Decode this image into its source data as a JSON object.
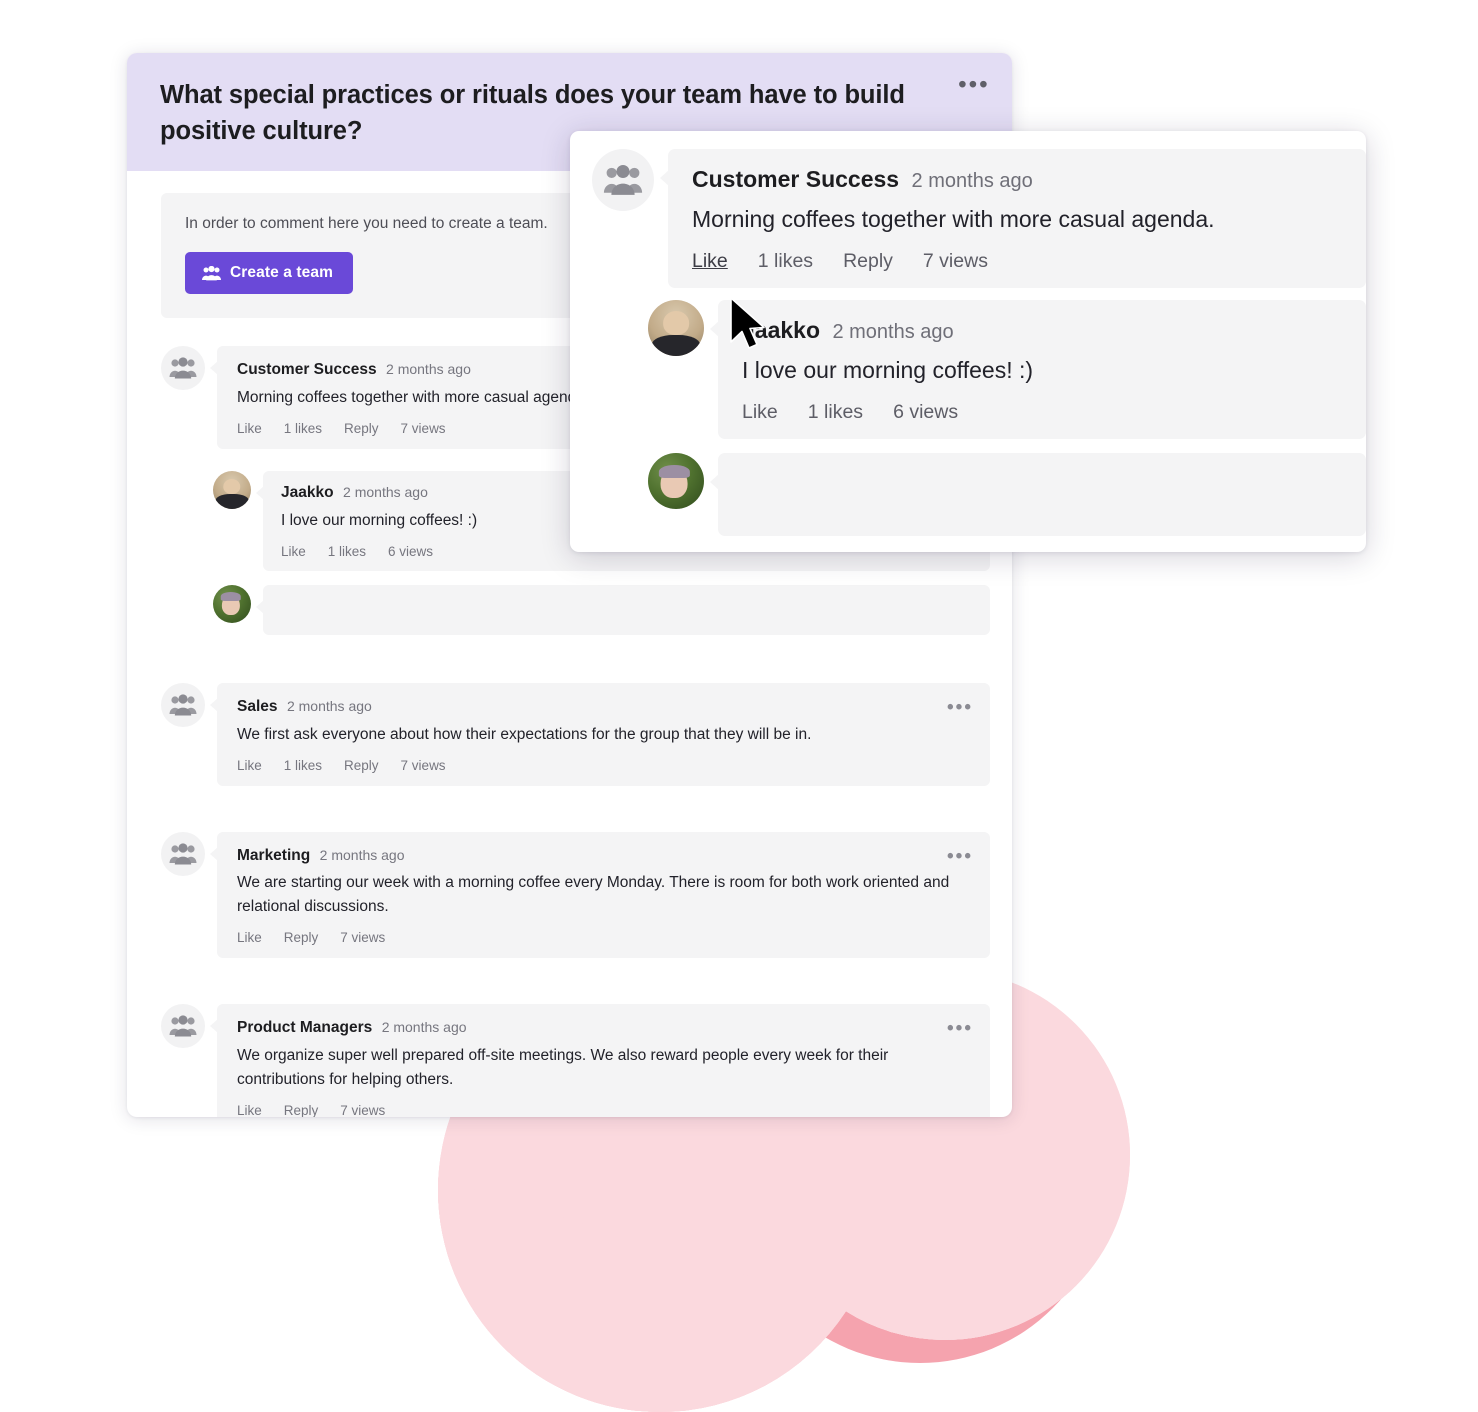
{
  "question": {
    "title": "What special practices or rituals does your team have to build positive culture?",
    "menu_icon": "•••"
  },
  "compose": {
    "notice": "In order to comment here you need to create a team.",
    "create_team_label": "Create a team",
    "create_team_icon": "users-group-icon"
  },
  "colors": {
    "header_bg": "#e3ddf4",
    "brand_purple": "#6a49d8",
    "bubble_bg": "#f4f4f5",
    "blob_pink_dark": "#f5a3ae",
    "blob_pink_light": "#fbd9de"
  },
  "comments": [
    {
      "author": "Customer Success",
      "time": "2 months ago",
      "body": "Morning coffees together with more casual agenda.",
      "actions": {
        "like": "Like",
        "likes": "1 likes",
        "reply": "Reply",
        "views": "7 views"
      },
      "avatar": "group-avatar-icon",
      "replies": [
        {
          "author": "Jaakko",
          "time": "2 months ago",
          "body": "I love our morning coffees! :)",
          "actions": {
            "like": "Like",
            "likes": "1 likes",
            "views": "6 views"
          },
          "avatar": "jaakko-photo-avatar"
        },
        {
          "author": "",
          "time": "",
          "body": "",
          "avatar": "woman-photo-avatar"
        }
      ]
    },
    {
      "author": "Sales",
      "time": "2 months ago",
      "body": "We first ask everyone about how their expectations for the group that they will be in.",
      "actions": {
        "like": "Like",
        "likes": "1 likes",
        "reply": "Reply",
        "views": "7 views"
      },
      "avatar": "group-avatar-icon",
      "menu_icon": "•••"
    },
    {
      "author": "Marketing",
      "time": "2 months ago",
      "body": "We are starting our week with a morning coffee every Monday. There is room for both work oriented and relational discussions.",
      "actions": {
        "like": "Like",
        "reply": "Reply",
        "views": "7 views"
      },
      "avatar": "group-avatar-icon",
      "menu_icon": "•••"
    },
    {
      "author": "Product Managers",
      "time": "2 months ago",
      "body": "We organize super well prepared off-site meetings. We also reward people every week for their contributions for helping others.",
      "actions": {
        "like": "Like",
        "reply": "Reply",
        "views": "7 views"
      },
      "avatar": "group-avatar-icon",
      "menu_icon": "•••"
    }
  ],
  "popup": {
    "comment": {
      "author": "Customer Success",
      "time": "2 months ago",
      "body": "Morning coffees together with more casual agenda.",
      "actions": {
        "like": "Like",
        "likes": "1 likes",
        "reply": "Reply",
        "views": "7 views"
      },
      "avatar": "group-avatar-icon"
    },
    "reply": {
      "author": "Jaakko",
      "time": "2 months ago",
      "body": "I love our morning coffees! :)",
      "actions": {
        "like": "Like",
        "likes": "1 likes",
        "views": "6 views"
      },
      "avatar": "jaakko-photo-avatar"
    },
    "reply_empty": {
      "avatar": "woman-photo-avatar"
    }
  },
  "cursor": {
    "icon": "mouse-pointer-arrow"
  }
}
